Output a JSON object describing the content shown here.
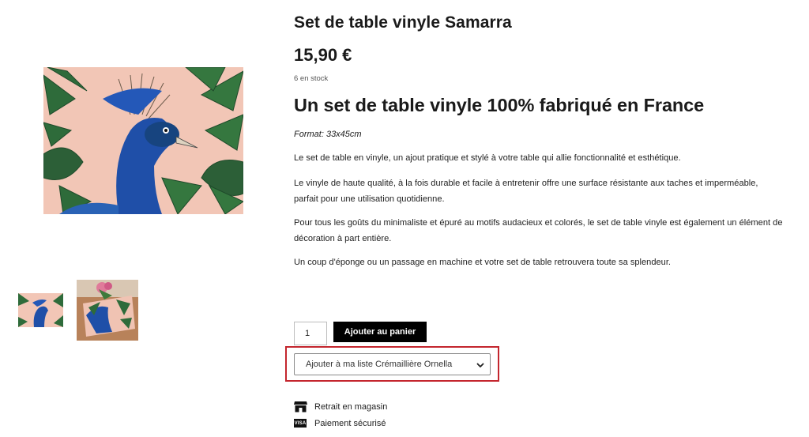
{
  "product": {
    "title": "Set de table vinyle Samarra",
    "price": "15,90 €",
    "stock": "6 en stock"
  },
  "description": {
    "headline": "Un set de table vinyle 100% fabriqué en France",
    "format": "Format: 33x45cm",
    "paragraphs": [
      "Le set de table en vinyle, un ajout pratique et stylé à votre table qui allie fonctionnalité et esthétique.",
      "Le vinyle de haute qualité, à la fois durable et facile à entretenir offre une surface résistante aux taches et imperméable, parfait pour une utilisation quotidienne.",
      "Pour tous les goûts du minimaliste et épuré au motifs audacieux et colorés, le set de table vinyle est également un élément de décoration à part entière.",
      "Un coup d'éponge ou un passage en machine et votre set de table retrouvera toute sa splendeur."
    ]
  },
  "cart": {
    "quantity": "1",
    "add_label": "Ajouter au panier"
  },
  "wishlist": {
    "selected": "Ajouter à ma liste Crémaillière Ornella"
  },
  "features": [
    {
      "icon": "store-icon",
      "label": "Retrait en magasin"
    },
    {
      "icon": "visa-card-icon",
      "label": "Paiement sécurisé",
      "icon_text": "VISA"
    }
  ],
  "images": {
    "main_alt": "peacock-among-tropical-leaves-placemat",
    "thumbs": [
      "peacock-placemat-thumbnail",
      "placemat-on-table-thumbnail"
    ]
  },
  "colors": {
    "button_bg": "#000000",
    "highlight_border": "#c4262e",
    "image_background": "#f2c6b6",
    "peacock_blue": "#1f4fa8",
    "leaf_green": "#2e6b3a"
  }
}
